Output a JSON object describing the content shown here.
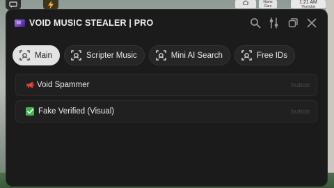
{
  "window": {
    "title": "VOID MUSIC STEALER | PRO",
    "title_icon": "purple-gem-emoji"
  },
  "toolbar": {
    "icons": [
      "search-icon",
      "settings-sliders-icon",
      "minimize-icon",
      "close-icon"
    ]
  },
  "tabs": [
    {
      "label": "Main",
      "icon": "tab-target-icon",
      "active": true
    },
    {
      "label": "Scripter Music",
      "icon": "tab-target-icon",
      "active": false
    },
    {
      "label": "Mini AI Search",
      "icon": "tab-target-icon",
      "active": false
    },
    {
      "label": "Free IDs",
      "icon": "tab-target-icon",
      "active": false
    }
  ],
  "rows": [
    {
      "label": "Void Spammer",
      "emoji": "megaphone-icon",
      "hint": "button"
    },
    {
      "label": "Fake Verified (Visual)",
      "emoji": "check-mark-icon",
      "hint": "button"
    }
  ],
  "background": {
    "top_tags": [
      "Name",
      "Cars"
    ],
    "clock": "1:21 AM",
    "day": "Thursday"
  },
  "colors": {
    "panel": "#1b1b1b",
    "tab_active": "#e3e3e3",
    "tab_inactive": "#262626",
    "row": "#202020",
    "accent_check": "#3fb54e"
  }
}
